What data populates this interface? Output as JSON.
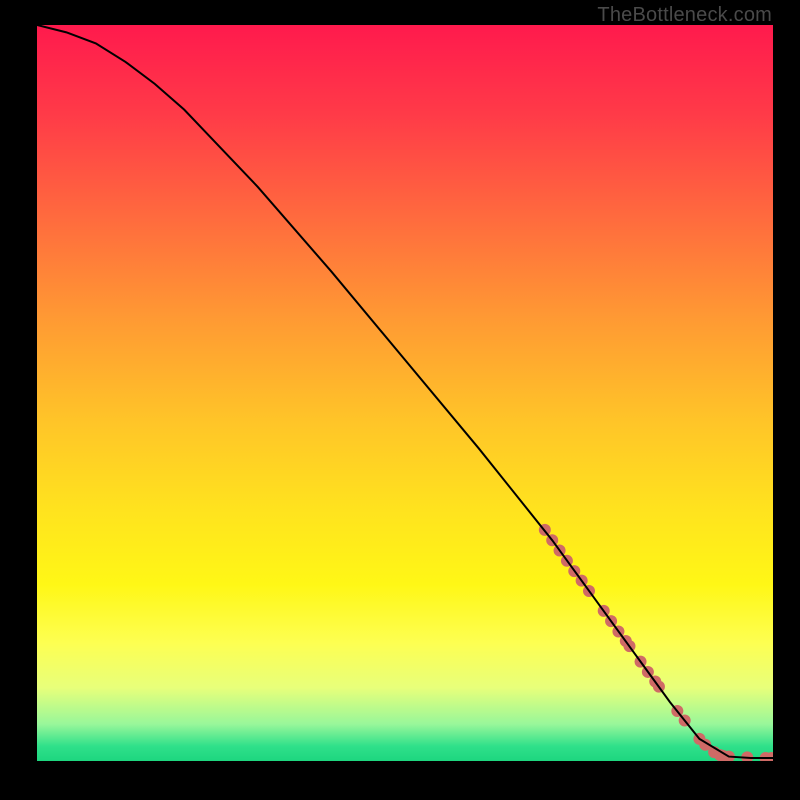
{
  "watermark": "TheBottleneck.com",
  "chart_data": {
    "type": "line",
    "title": "",
    "xlabel": "",
    "ylabel": "",
    "xlim": [
      0,
      100
    ],
    "ylim": [
      0,
      100
    ],
    "grid": false,
    "series": [
      {
        "name": "curve",
        "color": "#000000",
        "x": [
          0,
          4,
          8,
          12,
          16,
          20,
          30,
          40,
          50,
          60,
          70,
          78,
          82,
          86,
          90,
          94,
          97,
          100
        ],
        "y": [
          100,
          99,
          97.5,
          95,
          92,
          88.5,
          78,
          66.5,
          54.5,
          42.5,
          30,
          19,
          13.5,
          8,
          3,
          0.6,
          0.4,
          0.4
        ]
      }
    ],
    "markers": {
      "name": "highlight-band",
      "color": "#cf6a66",
      "radius_px": 6,
      "points": [
        {
          "x": 69.0,
          "y": 31.4
        },
        {
          "x": 70.0,
          "y": 30.0
        },
        {
          "x": 71.0,
          "y": 28.6
        },
        {
          "x": 72.0,
          "y": 27.2
        },
        {
          "x": 73.0,
          "y": 25.8
        },
        {
          "x": 74.0,
          "y": 24.5
        },
        {
          "x": 75.0,
          "y": 23.1
        },
        {
          "x": 77.0,
          "y": 20.4
        },
        {
          "x": 78.0,
          "y": 19.0
        },
        {
          "x": 79.0,
          "y": 17.6
        },
        {
          "x": 80.0,
          "y": 16.3
        },
        {
          "x": 80.5,
          "y": 15.6
        },
        {
          "x": 82.0,
          "y": 13.5
        },
        {
          "x": 83.0,
          "y": 12.1
        },
        {
          "x": 84.0,
          "y": 10.8
        },
        {
          "x": 84.5,
          "y": 10.1
        },
        {
          "x": 87.0,
          "y": 6.8
        },
        {
          "x": 88.0,
          "y": 5.5
        },
        {
          "x": 90.0,
          "y": 3.0
        },
        {
          "x": 90.8,
          "y": 2.2
        },
        {
          "x": 92.0,
          "y": 1.2
        },
        {
          "x": 92.8,
          "y": 0.8
        },
        {
          "x": 93.2,
          "y": 0.7
        },
        {
          "x": 94.0,
          "y": 0.6
        },
        {
          "x": 96.5,
          "y": 0.5
        },
        {
          "x": 99.0,
          "y": 0.4
        },
        {
          "x": 99.8,
          "y": 0.4
        }
      ]
    }
  }
}
